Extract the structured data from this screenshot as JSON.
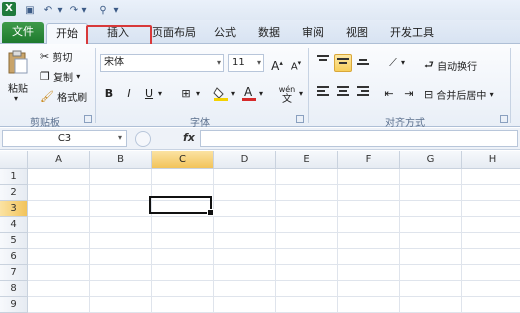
{
  "qat": {
    "logo": "X",
    "save": "▣",
    "undo": "↶",
    "redo": "↷",
    "customize": "⚲",
    "more": "▾"
  },
  "tabs": [
    {
      "label": "文件"
    },
    {
      "label": "开始"
    },
    {
      "label": "插入"
    },
    {
      "label": "页面布局"
    },
    {
      "label": "公式"
    },
    {
      "label": "数据"
    },
    {
      "label": "审阅"
    },
    {
      "label": "视图"
    },
    {
      "label": "开发工具"
    }
  ],
  "clipboard": {
    "paste": "粘贴",
    "cut": "剪切",
    "copy": "复制",
    "format_painter": "格式刷",
    "group": "剪贴板"
  },
  "font": {
    "name": "宋体",
    "size": "11",
    "grow": "A",
    "shrink": "A",
    "bold": "B",
    "italic": "I",
    "underline": "U",
    "phonetic": "wén",
    "group": "字体"
  },
  "alignment": {
    "wrap": "自动换行",
    "merge": "合并后居中",
    "group": "对齐方式"
  },
  "formula_bar": {
    "name_box": "C3",
    "fx": "fx"
  },
  "columns": [
    "A",
    "B",
    "C",
    "D",
    "E",
    "F",
    "G",
    "H"
  ],
  "rows": [
    "1",
    "2",
    "3",
    "4",
    "5",
    "6",
    "7",
    "8",
    "9"
  ],
  "selection": {
    "column": "C",
    "row": "3"
  }
}
